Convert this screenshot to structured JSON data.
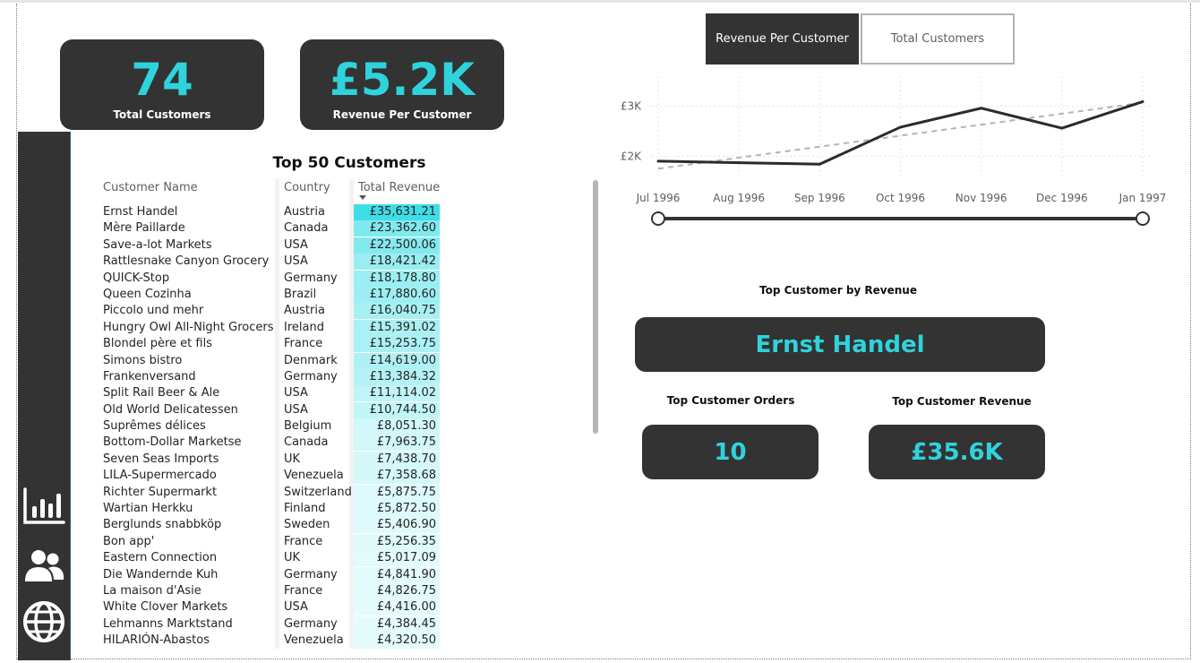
{
  "kpis": {
    "total_customers": {
      "value": "74",
      "label": "Total Customers"
    },
    "revenue_per_customer": {
      "value": "£5.2K",
      "label": "Revenue Per Customer"
    }
  },
  "sidebar": {
    "icons": [
      "bar-chart-icon",
      "users-icon",
      "globe-icon"
    ]
  },
  "table": {
    "title": "Top 50 Customers",
    "columns": [
      "Customer Name",
      "Country",
      "Total Revenue"
    ],
    "max_revenue": 35631.21,
    "rows": [
      {
        "name": "Ernst Handel",
        "country": "Austria",
        "revenue": "£35,631.21",
        "value": 35631.21
      },
      {
        "name": "Mère Paillarde",
        "country": "Canada",
        "revenue": "£23,362.60",
        "value": 23362.6
      },
      {
        "name": "Save-a-lot Markets",
        "country": "USA",
        "revenue": "£22,500.06",
        "value": 22500.06
      },
      {
        "name": "Rattlesnake Canyon Grocery",
        "country": "USA",
        "revenue": "£18,421.42",
        "value": 18421.42
      },
      {
        "name": "QUICK-Stop",
        "country": "Germany",
        "revenue": "£18,178.80",
        "value": 18178.8
      },
      {
        "name": "Queen Cozinha",
        "country": "Brazil",
        "revenue": "£17,880.60",
        "value": 17880.6
      },
      {
        "name": "Piccolo und mehr",
        "country": "Austria",
        "revenue": "£16,040.75",
        "value": 16040.75
      },
      {
        "name": "Hungry Owl All-Night Grocers",
        "country": "Ireland",
        "revenue": "£15,391.02",
        "value": 15391.02
      },
      {
        "name": "Blondel père et fils",
        "country": "France",
        "revenue": "£15,253.75",
        "value": 15253.75
      },
      {
        "name": "Simons bistro",
        "country": "Denmark",
        "revenue": "£14,619.00",
        "value": 14619.0
      },
      {
        "name": "Frankenversand",
        "country": "Germany",
        "revenue": "£13,384.32",
        "value": 13384.32
      },
      {
        "name": "Split Rail Beer & Ale",
        "country": "USA",
        "revenue": "£11,114.02",
        "value": 11114.02
      },
      {
        "name": "Old World Delicatessen",
        "country": "USA",
        "revenue": "£10,744.50",
        "value": 10744.5
      },
      {
        "name": "Suprêmes délices",
        "country": "Belgium",
        "revenue": "£8,051.30",
        "value": 8051.3
      },
      {
        "name": "Bottom-Dollar Marketse",
        "country": "Canada",
        "revenue": "£7,963.75",
        "value": 7963.75
      },
      {
        "name": "Seven Seas Imports",
        "country": "UK",
        "revenue": "£7,438.70",
        "value": 7438.7
      },
      {
        "name": "LILA-Supermercado",
        "country": "Venezuela",
        "revenue": "£7,358.68",
        "value": 7358.68
      },
      {
        "name": "Richter Supermarkt",
        "country": "Switzerland",
        "revenue": "£5,875.75",
        "value": 5875.75
      },
      {
        "name": "Wartian Herkku",
        "country": "Finland",
        "revenue": "£5,872.50",
        "value": 5872.5
      },
      {
        "name": "Berglunds snabbköp",
        "country": "Sweden",
        "revenue": "£5,406.90",
        "value": 5406.9
      },
      {
        "name": "Bon app'",
        "country": "France",
        "revenue": "£5,256.35",
        "value": 5256.35
      },
      {
        "name": "Eastern Connection",
        "country": "UK",
        "revenue": "£5,017.09",
        "value": 5017.09
      },
      {
        "name": "Die Wandernde Kuh",
        "country": "Germany",
        "revenue": "£4,841.90",
        "value": 4841.9
      },
      {
        "name": "La maison d'Asie",
        "country": "France",
        "revenue": "£4,826.75",
        "value": 4826.75
      },
      {
        "name": "White Clover Markets",
        "country": "USA",
        "revenue": "£4,416.00",
        "value": 4416.0
      },
      {
        "name": "Lehmanns Marktstand",
        "country": "Germany",
        "revenue": "£4,384.45",
        "value": 4384.45
      },
      {
        "name": "HILARIÓN-Abastos",
        "country": "Venezuela",
        "revenue": "£4,320.50",
        "value": 4320.5
      }
    ]
  },
  "toggle": {
    "active_label": "Revenue Per Customer",
    "inactive_label": "Total Customers"
  },
  "chart_data": {
    "type": "line",
    "x": [
      "Jul 1996",
      "Aug 1996",
      "Sep 1996",
      "Oct 1996",
      "Nov 1996",
      "Dec 1996",
      "Jan 1997"
    ],
    "series": [
      {
        "values": [
          1900,
          1870,
          1840,
          2580,
          2960,
          2560,
          3090
        ]
      }
    ],
    "trend": [
      1750,
      1970,
      2190,
      2410,
      2630,
      2850,
      3070
    ],
    "ytick_values": [
      2000,
      3000
    ],
    "ytick_labels": [
      "£2K",
      "£3K"
    ],
    "ylim": [
      1540,
      3600
    ],
    "grid": true,
    "colors": {
      "series": "#2b2b2b",
      "trend": "#b3b3b3"
    }
  },
  "top_customer": {
    "label": "Top Customer by Revenue",
    "name": "Ernst Handel",
    "orders_label": "Top Customer Orders",
    "orders_value": "10",
    "revenue_label": "Top Customer Revenue",
    "revenue_value": "£35.6K"
  },
  "colors": {
    "accent": "#2fd3dc",
    "card_bg": "#333333",
    "bar_strong": "#3fdde6",
    "bar_light": "#e6fbfc"
  }
}
